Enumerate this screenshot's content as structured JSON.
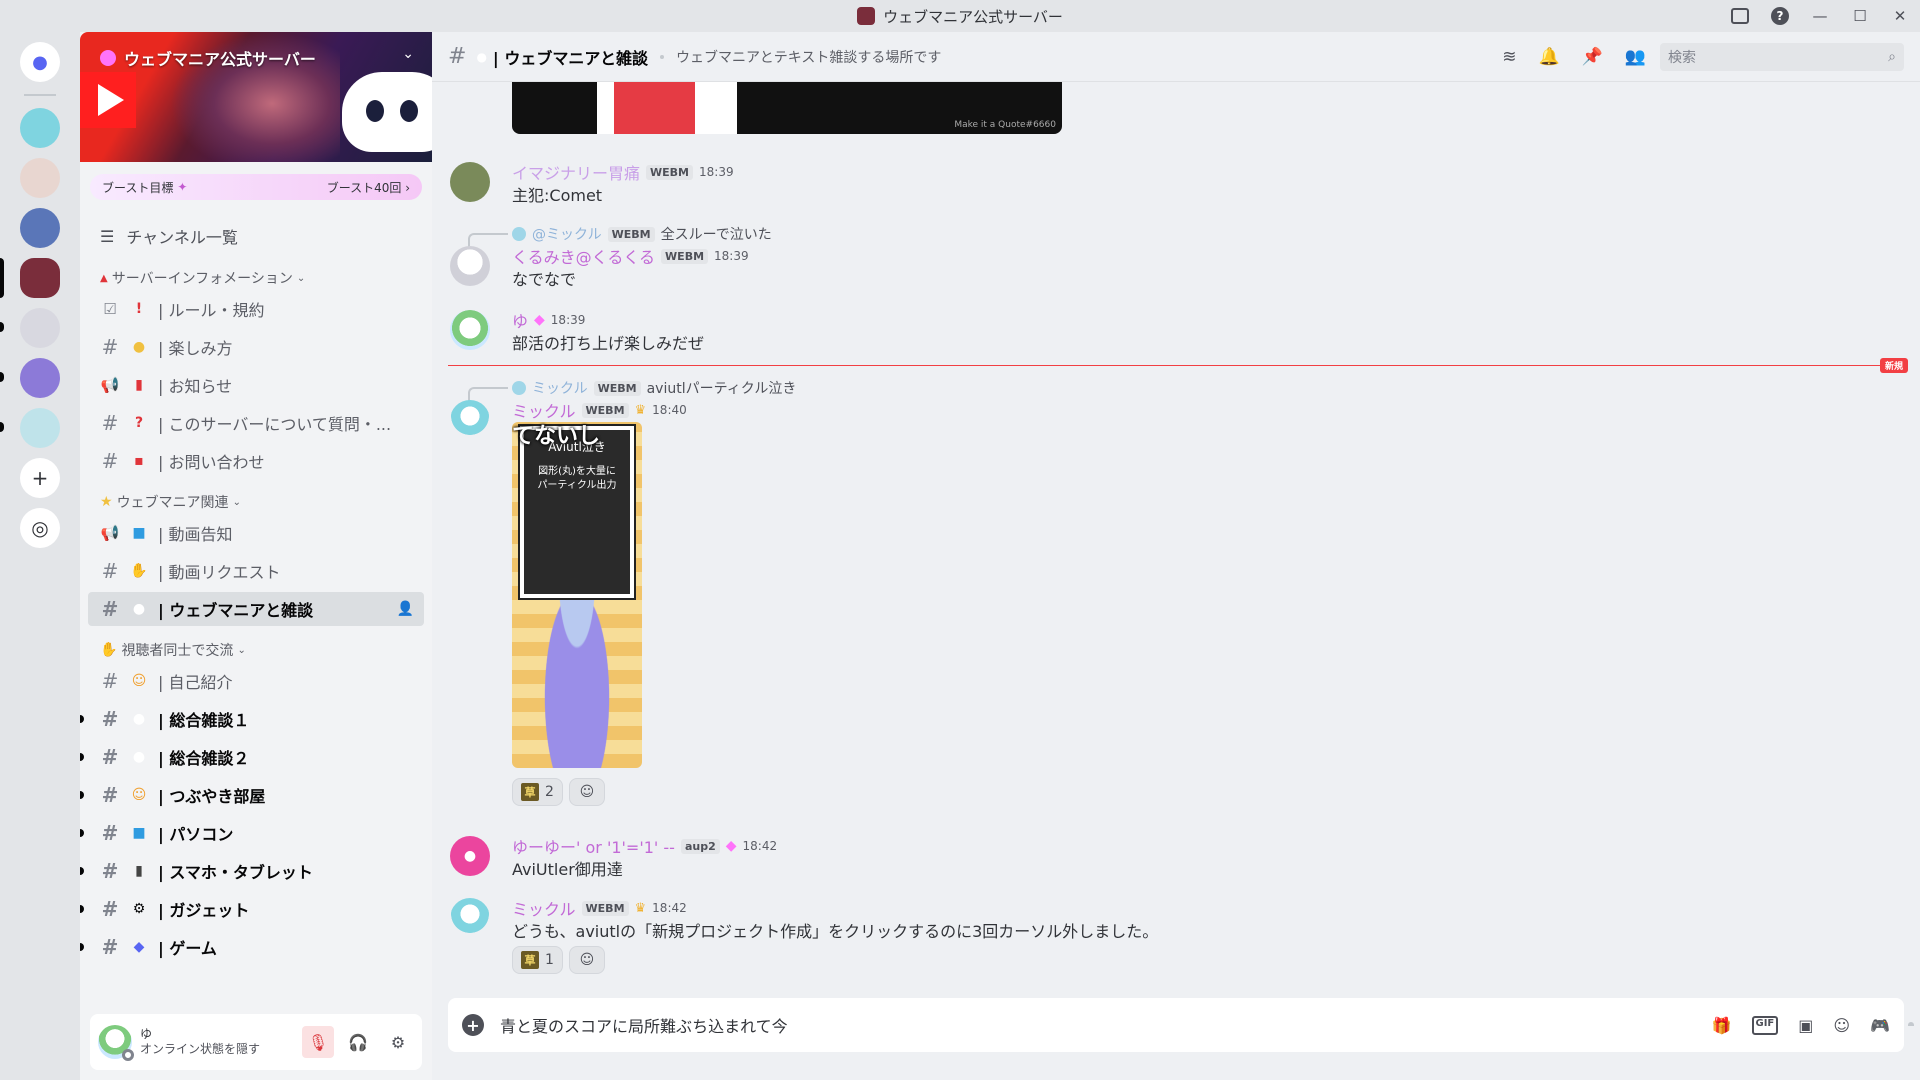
{
  "window": {
    "title": "ウェブマニア公式サーバー"
  },
  "server": {
    "name": "ウェブマニア公式サーバー",
    "boost_goal_label": "ブースト目標",
    "boost_count": "ブースト40回 ›",
    "channel_list_label": "チャンネル一覧"
  },
  "categories": {
    "info": "サーバーインフォメーション",
    "webmania": "ウェブマニア関連",
    "viewers": "視聴者同士で交流"
  },
  "channels": {
    "rules": "| ルール・規約",
    "howto": "| 楽しみ方",
    "news": "| お知らせ",
    "faq": "| このサーバーについて質問・...",
    "contact": "| お問い合わせ",
    "video_notice": "| 動画告知",
    "video_request": "| 動画リクエスト",
    "chat": "| ウェブマニアと雑談",
    "intro": "| 自己紹介",
    "general1": "| 総合雑談１",
    "general2": "| 総合雑談２",
    "tweet": "| つぶやき部屋",
    "pc": "| パソコン",
    "phone": "| スマホ・タブレット",
    "gadget": "| ガジェット",
    "game": "| ゲーム"
  },
  "user_panel": {
    "name": "ゆ",
    "status": "オンライン状態を隠す"
  },
  "header": {
    "channel": "| ウェブマニアと雑談",
    "topic": "ウェブマニアとテキスト雑談する場所です",
    "search_placeholder": "検索"
  },
  "preview_image": {
    "watermark": "Make it a Quote#6660"
  },
  "messages": [
    {
      "author": "イマジナリー胃痛",
      "tag": "WEBM",
      "time": "18:39",
      "text": "主犯:Comet"
    },
    {
      "reply_author": "@ミックル",
      "reply_tag": "WEBM",
      "reply_text": "全スルーで泣いた",
      "author": "くるみき@くるくる",
      "tag": "WEBM",
      "time": "18:39",
      "text": "なでなで"
    },
    {
      "author": "ゆ",
      "time": "18:39",
      "text": "部活の打ち上げ楽しみだぜ"
    },
    {
      "reply_author": "ミックル",
      "reply_tag": "WEBM",
      "reply_text": "aviutlパーティクル泣き",
      "author": "ミックル",
      "tag": "WEBM",
      "time": "18:40",
      "image_overlay": "てないし",
      "image_title": "Aviutl泣き",
      "image_caption1": "図形(丸)を大量に",
      "image_caption2": "パーティクル出力",
      "reaction_count": "2"
    },
    {
      "author": "ゆーゆー' or '1'='1' --",
      "tag": "aup2",
      "time": "18:42",
      "text": "AviUtler御用達"
    },
    {
      "author": "ミックル",
      "tag": "WEBM",
      "time": "18:42",
      "text": "どうも、aviutlの「新規プロジェクト作成」をクリックするのに3回カーソル外しました。",
      "reaction_count": "1"
    }
  ],
  "new_divider_label": "新規",
  "composer": {
    "text": "青と夏のスコアに局所難ぶち込まれて今",
    "gif_label": "GIF"
  },
  "reaction_emoji_glyph": "草",
  "colors": {
    "accent": "#5865f2",
    "danger": "#f23f43",
    "name_pink": "#c26ad6",
    "name_teal": "#8fb3d9"
  }
}
